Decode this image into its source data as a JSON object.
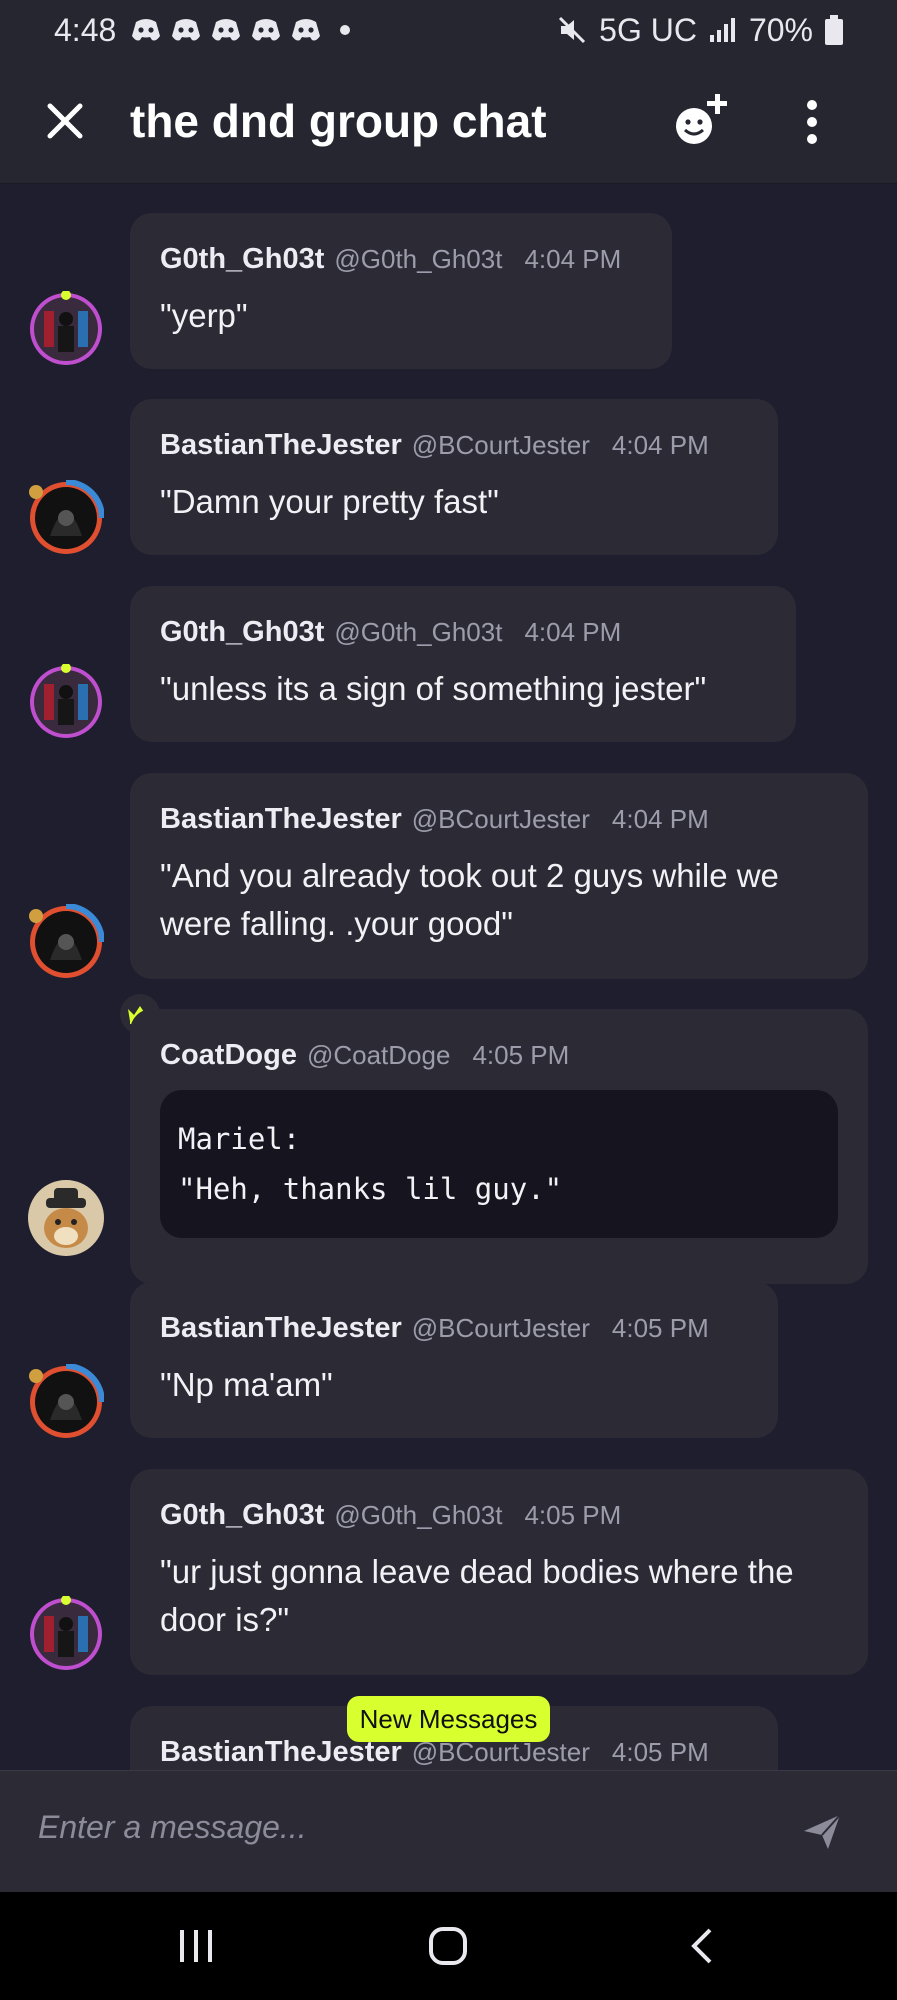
{
  "status_bar": {
    "time": "4:48",
    "network": "5G UC",
    "battery": "70%",
    "icons": [
      "discord-icon",
      "discord-icon",
      "discord-icon",
      "discord-icon",
      "discord-icon",
      "mute-icon",
      "signal-icon",
      "battery-icon"
    ]
  },
  "header": {
    "title": "the dnd group chat",
    "close_icon": "close-icon",
    "add_reaction_icon": "emoji-add-icon",
    "menu_icon": "kebab-menu-icon"
  },
  "messages": [
    {
      "name": "G0th_Gh03t",
      "handle": "@G0th_Gh03t",
      "time": "4:04 PM",
      "text": "\"yerp\""
    },
    {
      "name": "BastianTheJester",
      "handle": "@BCourtJester",
      "time": "4:04 PM",
      "text": "\"Damn your pretty fast\""
    },
    {
      "name": "G0th_Gh03t",
      "handle": "@G0th_Gh03t",
      "time": "4:04 PM",
      "text": "\"unless its a sign of something jester\""
    },
    {
      "name": "BastianTheJester",
      "handle": "@BCourtJester",
      "time": "4:04 PM",
      "text": "\"And you already took out 2 guys while we were falling. .your good\""
    },
    {
      "name": "CoatDoge",
      "handle": "@CoatDoge",
      "time": "4:05 PM",
      "code_lines": [
        "Mariel:",
        "\"Heh, thanks lil guy.\""
      ]
    },
    {
      "name": "BastianTheJester",
      "handle": "@BCourtJester",
      "time": "4:05 PM",
      "text": "\"Np ma'am\""
    },
    {
      "name": "G0th_Gh03t",
      "handle": "@G0th_Gh03t",
      "time": "4:05 PM",
      "text": "\"ur just gonna leave dead bodies where the door is?\""
    },
    {
      "name": "BastianTheJester",
      "handle": "@BCourtJester",
      "time": "4:05 PM",
      "text": ""
    }
  ],
  "new_messages_label": "New Messages",
  "composer": {
    "placeholder": "Enter a message...",
    "send_icon": "send-icon"
  },
  "navbar": {
    "icons": [
      "recent-apps-icon",
      "home-icon",
      "back-icon"
    ]
  },
  "colors": {
    "background": "#1f1e2e",
    "bubble": "#2b2a35",
    "accent": "#d8ff2e",
    "code_bg": "#15141f"
  }
}
